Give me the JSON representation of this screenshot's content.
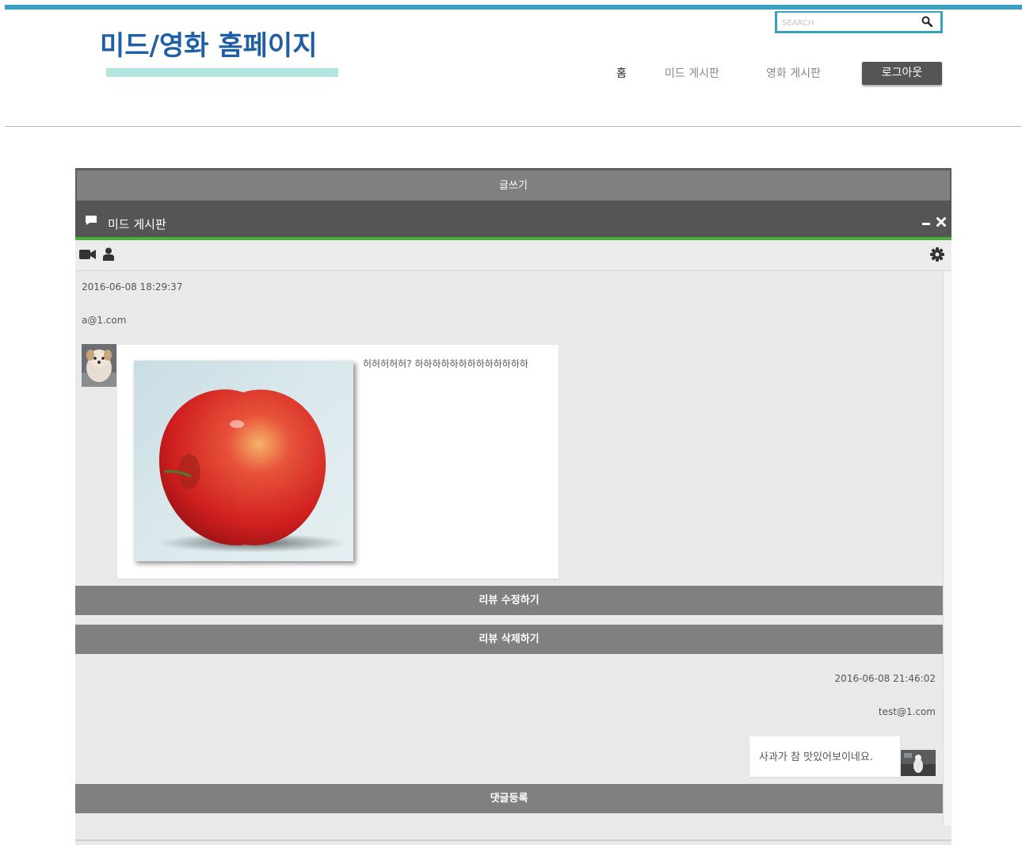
{
  "header": {
    "site_title": "미드/영화 홈페이지",
    "search_placeholder": "SEARCH",
    "nav": {
      "home": "홈",
      "mid_board": "미드 게시판",
      "movie_board": "영화 게시판"
    },
    "logout_label": "로그아웃"
  },
  "board": {
    "write_label": "글쓰기",
    "title": "미드 게시판",
    "icons": [
      "chat-icon",
      "minus-icon",
      "close-icon",
      "video-camera-icon",
      "user-icon",
      "gear-icon"
    ],
    "accent_color": "#4cae3a"
  },
  "post": {
    "date": "2016-06-08 18:29:37",
    "email": "a@1.com",
    "text": "허허허허허? 하하하하하하하하하하하하하"
  },
  "actions": {
    "edit_label": "리뷰 수정하기",
    "delete_label": "리뷰 삭제하기",
    "comment_submit_label": "댓글등록"
  },
  "comment": {
    "date": "2016-06-08 21:46:02",
    "email": "test@1.com",
    "text": "사과가 참 맛있어보이네요."
  }
}
